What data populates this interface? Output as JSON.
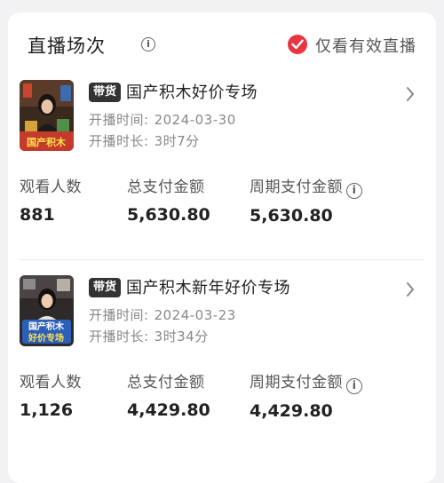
{
  "header": {
    "title": "直播场次",
    "info_icon": "info-circle-icon",
    "filter_label": "仅看有效直播",
    "filter_checked": true,
    "accent": "#e8353f"
  },
  "sessions": [
    {
      "badge": "带货",
      "title": "国产积木好价专场",
      "start_label": "开播时间:",
      "start_value": "2024-03-30",
      "duration_label": "开播时长:",
      "duration_value": "3时7分",
      "thumb_text": "国产积木",
      "stats": {
        "viewers_label": "观看人数",
        "viewers_value": "881",
        "payment_label": "总支付金额",
        "payment_value": "5,630.80",
        "period_label": "周期支付金额",
        "period_value": "5,630.80"
      }
    },
    {
      "badge": "带货",
      "title": "国产积木新年好价专场",
      "start_label": "开播时间:",
      "start_value": "2024-03-23",
      "duration_label": "开播时长:",
      "duration_value": "3时34分",
      "thumb_text_line1": "国产积木",
      "thumb_text_line2": "好价专场",
      "stats": {
        "viewers_label": "观看人数",
        "viewers_value": "1,126",
        "payment_label": "总支付金额",
        "payment_value": "4,429.80",
        "period_label": "周期支付金额",
        "period_value": "4,429.80"
      }
    }
  ]
}
